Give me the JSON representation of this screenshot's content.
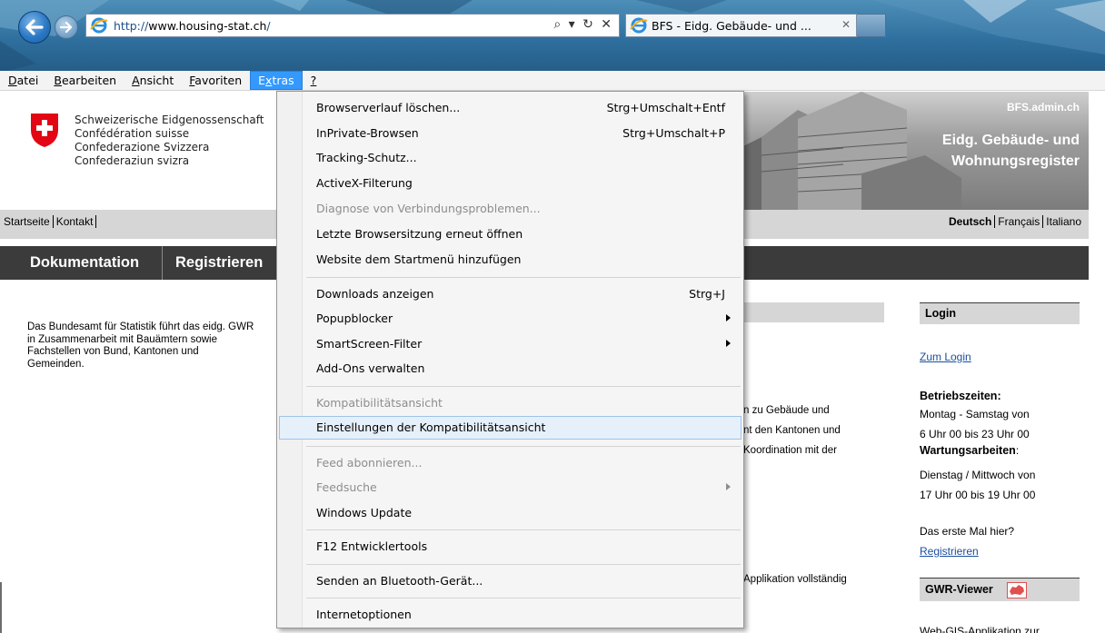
{
  "browser": {
    "url_scheme": "http://",
    "url_host": "www.housing-stat.ch",
    "url_path": "/",
    "address_tools": "⌕ ▾ ↻ ✕",
    "tab_title": "BFS - Eidg. Gebäude- und ...",
    "tab_close": "✕"
  },
  "menubar": {
    "items": [
      {
        "label": "Datei",
        "accel": "D"
      },
      {
        "label": "Bearbeiten",
        "accel": "B"
      },
      {
        "label": "Ansicht",
        "accel": "A"
      },
      {
        "label": "Favoriten",
        "accel": "F"
      },
      {
        "label": "Extras",
        "accel": ""
      },
      {
        "label": "?",
        "accel": "?"
      }
    ],
    "active": "Extras"
  },
  "site": {
    "logo_lines": [
      "Schweizerische Eidgenossenschaft",
      "Confédération suisse",
      "Confederazione Svizzera",
      "Confederaziun svizra"
    ],
    "bfs_admin": "BFS.admin.ch",
    "banner_title_1": "Eidg. Gebäude- und",
    "banner_title_2": "Wohnungsregister",
    "service_links": [
      "Startseite",
      "Kontakt"
    ],
    "languages": [
      "Deutsch",
      "Français",
      "Italiano"
    ],
    "nav": [
      "Dokumentation",
      "Registrieren"
    ],
    "intro_text": "Das Bundesamt für Statistik führt das eidg. GWR in Zusammenarbeit mit Bauämtern sowie Fachstellen von Bund, Kantonen und Gemeinden.",
    "center_fragments": [
      "n zu Gebäude und",
      "nt den Kantonen und",
      " Koordination mit der",
      "Applikation vollständig"
    ],
    "login": {
      "heading": "Login",
      "link": "Zum Login",
      "hours_heading": "Betriebszeiten:",
      "hours_1": "Montag - Samstag von",
      "hours_2": "6 Uhr 00 bis 23 Uhr 00",
      "maint_heading": "Wartungsarbeiten",
      "maint_colon": ":",
      "maint_1": "Dienstag / Mittwoch von",
      "maint_2": "17 Uhr 00 bis 19 Uhr 00",
      "first_time": "Das erste Mal hier?",
      "register_link": "Registrieren"
    },
    "gwr": {
      "heading": "GWR-Viewer",
      "text": "Web-GIS-Applikation zur"
    }
  },
  "extras_menu": {
    "items": [
      {
        "label": "Browserverlauf löschen...",
        "shortcut": "Strg+Umschalt+Entf",
        "enabled": true
      },
      {
        "label": "InPrivate-Browsen",
        "shortcut": "Strg+Umschalt+P",
        "enabled": true
      },
      {
        "label": "Tracking-Schutz...",
        "shortcut": "",
        "enabled": true
      },
      {
        "label": "ActiveX-Filterung",
        "shortcut": "",
        "enabled": true
      },
      {
        "label": "Diagnose von Verbindungsproblemen...",
        "shortcut": "",
        "enabled": false
      },
      {
        "label": "Letzte Browsersitzung erneut öffnen",
        "shortcut": "",
        "enabled": true
      },
      {
        "label": "Website dem Startmenü hinzufügen",
        "shortcut": "",
        "enabled": true
      },
      {
        "label": "Downloads anzeigen",
        "shortcut": "Strg+J",
        "enabled": true
      },
      {
        "label": "Popupblocker",
        "shortcut": "",
        "enabled": true,
        "submenu": true
      },
      {
        "label": "SmartScreen-Filter",
        "shortcut": "",
        "enabled": true,
        "submenu": true
      },
      {
        "label": "Add-Ons verwalten",
        "shortcut": "",
        "enabled": true
      },
      {
        "label": "Kompatibilitätsansicht",
        "shortcut": "",
        "enabled": false
      },
      {
        "label": "Einstellungen der Kompatibilitätsansicht",
        "shortcut": "",
        "enabled": true,
        "highlighted": true
      },
      {
        "label": "Feed abonnieren...",
        "shortcut": "",
        "enabled": false
      },
      {
        "label": "Feedsuche",
        "shortcut": "",
        "enabled": false,
        "submenu": true
      },
      {
        "label": "Windows Update",
        "shortcut": "",
        "enabled": true
      },
      {
        "label": "F12 Entwicklertools",
        "shortcut": "",
        "enabled": true
      },
      {
        "label": "Senden an Bluetooth-Gerät...",
        "shortcut": "",
        "enabled": true
      },
      {
        "label": "Internetoptionen",
        "shortcut": "",
        "enabled": true
      }
    ]
  },
  "colors": {
    "menu_active": "#3399ff",
    "nav_bar": "#3b3b3b",
    "service_bar": "#d6d6d6",
    "link": "#1a4f9c",
    "swiss_red": "#e30613"
  }
}
